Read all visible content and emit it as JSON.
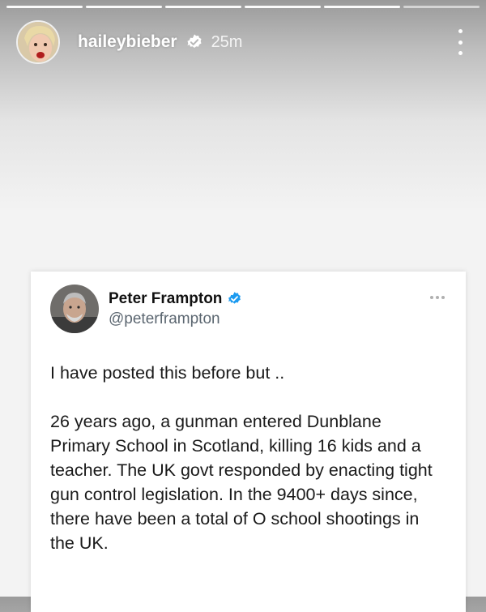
{
  "story": {
    "progress_segments": 6,
    "progress_completed": 5,
    "username": "haileybieber",
    "time": "25m",
    "verified_icon": "verified-badge-icon",
    "more_icon": "more-vertical-icon"
  },
  "tweet": {
    "display_name": "Peter Frampton",
    "handle": "@peterframpton",
    "verified_color": "#1d9bf0",
    "paragraphs": [
      "I have posted this before but ..",
      "26 years ago, a gunman entered Dunblane Primary School in Scotland, killing 16 kids and a teacher. The UK govt responded by enacting tight gun control legislation. In the 9400+ days since, there have been a total of O school shootings in the UK."
    ],
    "more_icon": "more-horizontal-icon"
  }
}
